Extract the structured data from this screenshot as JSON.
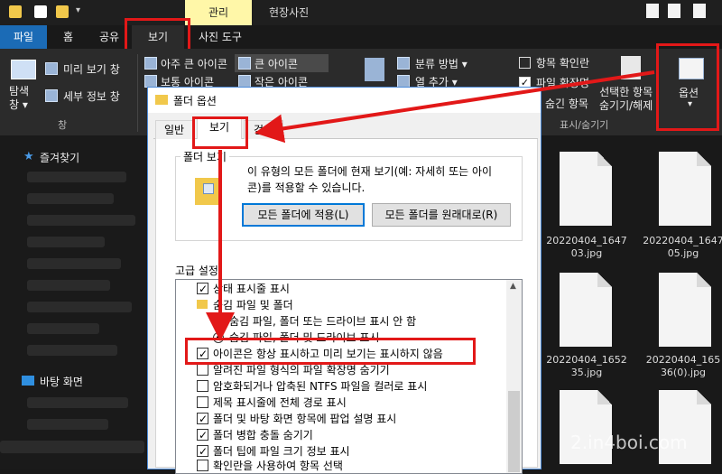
{
  "titlebar": {
    "context_tab": "관리",
    "window_title": "현장사진"
  },
  "ribbon_tabs": [
    {
      "label": "파일"
    },
    {
      "label": "홈"
    },
    {
      "label": "공유"
    },
    {
      "label": "보기"
    },
    {
      "label": "사진 도구"
    }
  ],
  "ribbon": {
    "pane": {
      "nav_label": "탐색\n창 ▾",
      "preview": "미리 보기 창",
      "details": "세부 정보 창",
      "group": "창"
    },
    "layout": {
      "xl_icons": "아주 큰 아이콘",
      "large_icons": "큰 아이콘",
      "medium_icons": "보통 아이콘",
      "small_icons": "작은 아이콘"
    },
    "view": {
      "sort": "분류 방법 ▾",
      "add_col": "열 추가 ▾"
    },
    "show_hide": {
      "item_checkbox": "항목 확인란",
      "extensions": "파일 확장명",
      "hidden_items": "숨긴 항목",
      "hide_selected": "선택한 항목\n숨기기/해제",
      "group": "표시/숨기기"
    },
    "options": {
      "label": "옵션",
      "arrow": "▾"
    }
  },
  "nav": {
    "favorites": "즐겨찾기",
    "desktop": "바탕 화면"
  },
  "files": [
    {
      "name": "20220404_1647\n03.jpg"
    },
    {
      "name": "20220404_1647\n05.jpg"
    },
    {
      "name": "20220404_1652\n35.jpg"
    },
    {
      "name": "20220404_165\n36(0).jpg"
    }
  ],
  "dialog": {
    "title": "폴더 옵션",
    "tabs": [
      {
        "label": "일반"
      },
      {
        "label": "보기"
      },
      {
        "label": "검색"
      }
    ],
    "folder_view": {
      "group": "폴더 보기",
      "desc": "이 유형의 모든 폴더에 현재 보기(예: 자세히 또는 아이\n콘)를 적용할 수 있습니다.",
      "apply_btn": "모든 폴더에 적용(L)",
      "reset_btn": "모든 폴더를 원래대로(R)"
    },
    "advanced_label": "고급 설정",
    "tree": [
      {
        "type": "checkbox",
        "checked": true,
        "indent": 0,
        "label": "상태 표시줄 표시"
      },
      {
        "type": "folder",
        "indent": 0,
        "label": "숨김 파일 및 폴더"
      },
      {
        "type": "radio",
        "on": false,
        "indent": 1,
        "label": "숨김 파일, 폴더 또는 드라이브 표시 안 함"
      },
      {
        "type": "radio",
        "on": true,
        "indent": 1,
        "label": "숨김 파일, 폴더 및 드라이브 표시"
      },
      {
        "type": "checkbox",
        "checked": true,
        "indent": 0,
        "label": "아이콘은 항상 표시하고 미리 보기는 표시하지 않음"
      },
      {
        "type": "checkbox",
        "checked": false,
        "indent": 0,
        "label": "알려진 파일 형식의 파일 확장명 숨기기"
      },
      {
        "type": "checkbox",
        "checked": false,
        "indent": 0,
        "label": "암호화되거나 압축된 NTFS 파일을 컬러로 표시"
      },
      {
        "type": "checkbox",
        "checked": false,
        "indent": 0,
        "label": "제목 표시줄에 전체 경로 표시"
      },
      {
        "type": "checkbox",
        "checked": true,
        "indent": 0,
        "label": "폴더 및 바탕 화면 항목에 팝업 설명 표시"
      },
      {
        "type": "checkbox",
        "checked": true,
        "indent": 0,
        "label": "폴더 병합 충돌 숨기기"
      },
      {
        "type": "checkbox",
        "checked": true,
        "indent": 0,
        "label": "폴더 팁에 파일 크기 정보 표시"
      },
      {
        "type": "checkbox",
        "checked": false,
        "indent": 0,
        "label": "확인란을 사용하여 항목 선택"
      }
    ]
  },
  "watermark": "2.in4boi.com",
  "colors": {
    "accent_red": "#e21818",
    "file_tab_blue": "#1b6bb6",
    "manage_tab": "#fff7a8"
  }
}
